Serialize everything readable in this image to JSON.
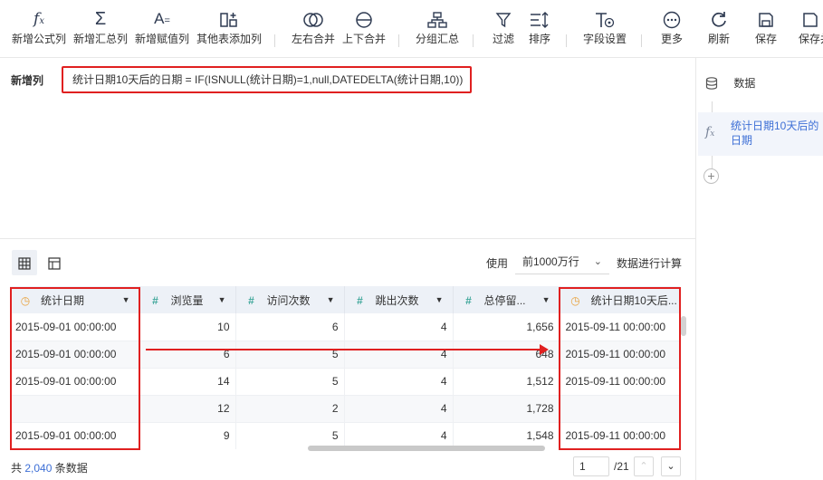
{
  "toolbar": {
    "items": [
      {
        "label": "新增公式列",
        "icon": "fx-icon"
      },
      {
        "label": "新增汇总列",
        "icon": "sigma-icon"
      },
      {
        "label": "新增赋值列",
        "icon": "assign-icon"
      },
      {
        "label": "其他表添加列",
        "icon": "add-column-icon"
      },
      {
        "label": "左右合并",
        "icon": "merge-lr-icon"
      },
      {
        "label": "上下合并",
        "icon": "merge-tb-icon"
      },
      {
        "label": "分组汇总",
        "icon": "group-icon"
      },
      {
        "label": "过滤",
        "icon": "filter-icon"
      },
      {
        "label": "排序",
        "icon": "sort-icon"
      },
      {
        "label": "字段设置",
        "icon": "field-settings-icon"
      },
      {
        "label": "更多",
        "icon": "more-icon"
      },
      {
        "label": "刷新",
        "icon": "refresh-icon"
      },
      {
        "label": "保存",
        "icon": "save-icon"
      },
      {
        "label": "保存并",
        "icon": "save-as-icon"
      }
    ]
  },
  "editor": {
    "column_label": "新增列",
    "formula": "统计日期10天后的日期 = IF(ISNULL(统计日期)=1,null,DATEDELTA(统计日期,10))"
  },
  "right_panel": {
    "data_label": "数据",
    "node_label": "统计日期10天后的日期",
    "add_label": "+"
  },
  "data_header": {
    "use_label": "使用",
    "row_limit": "前1000万行",
    "calc_label": "数据进行计算"
  },
  "table": {
    "columns": [
      {
        "label": "统计日期",
        "type": "date"
      },
      {
        "label": "浏览量",
        "type": "number"
      },
      {
        "label": "访问次数",
        "type": "number"
      },
      {
        "label": "跳出次数",
        "type": "number"
      },
      {
        "label": "总停留...",
        "type": "number"
      },
      {
        "label": "统计日期10天后...",
        "type": "date"
      }
    ],
    "rows": [
      [
        "2015-09-01 00:00:00",
        "10",
        "6",
        "4",
        "1,656",
        "2015-09-11 00:00:00"
      ],
      [
        "2015-09-01 00:00:00",
        "6",
        "5",
        "4",
        "648",
        "2015-09-11 00:00:00"
      ],
      [
        "2015-09-01 00:00:00",
        "14",
        "5",
        "4",
        "1,512",
        "2015-09-11 00:00:00"
      ],
      [
        "",
        "12",
        "2",
        "4",
        "1,728",
        ""
      ],
      [
        "2015-09-01 00:00:00",
        "9",
        "5",
        "4",
        "1,548",
        "2015-09-11 00:00:00"
      ]
    ]
  },
  "footer": {
    "total_prefix": "共",
    "total_count": "2,040",
    "total_suffix": "条数据",
    "page_current": "1",
    "page_total": "/21"
  },
  "colors": {
    "highlight": "#e02020",
    "accent": "#3d6fd6",
    "date_icon": "#e8a13b",
    "number_icon": "#40a79b"
  }
}
